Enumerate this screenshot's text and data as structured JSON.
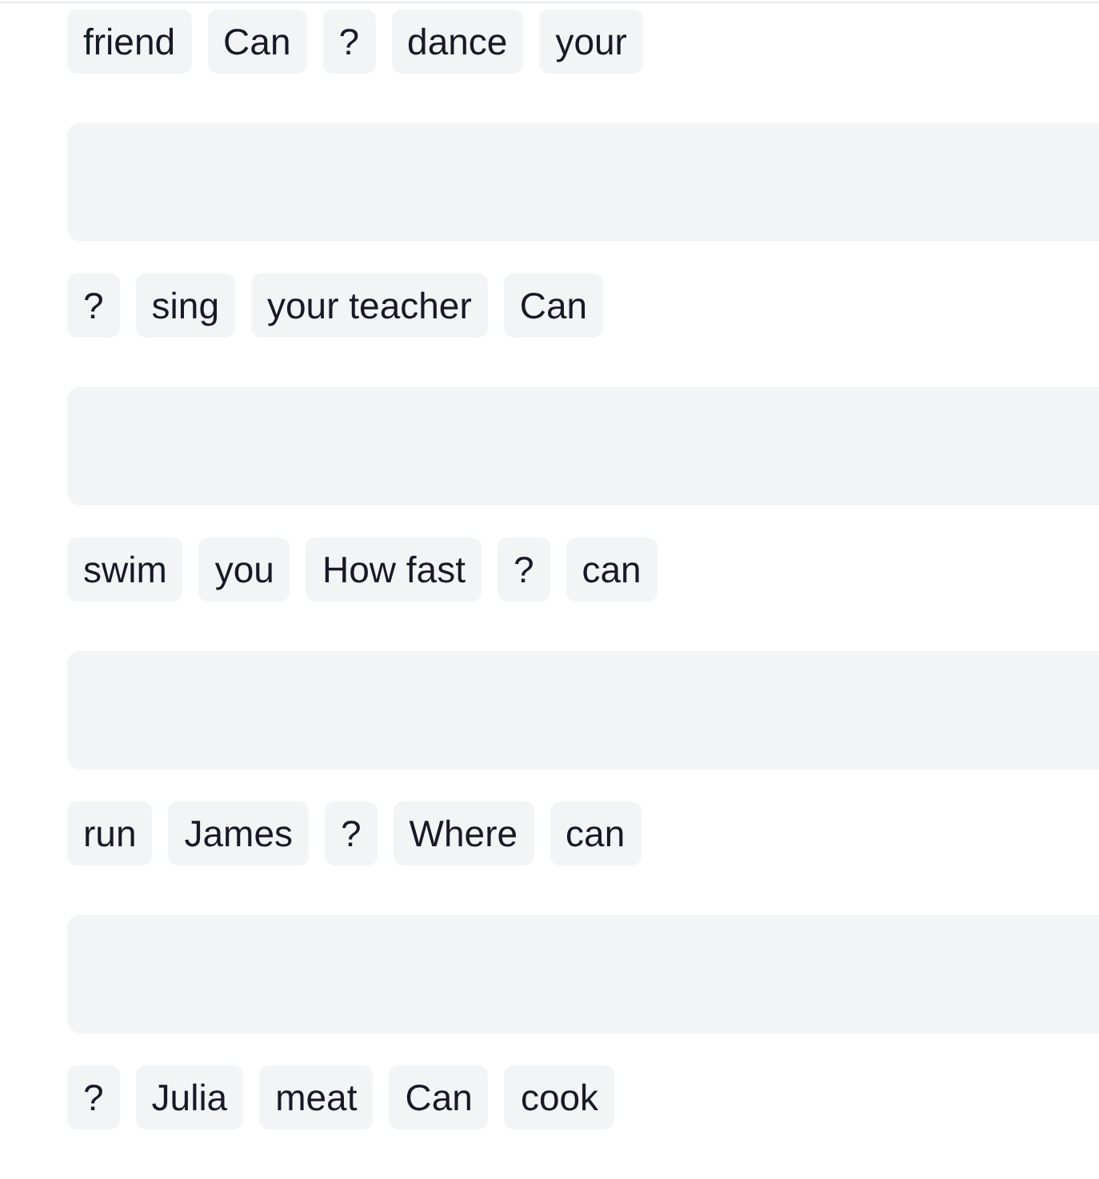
{
  "exercise_items": [
    {
      "kind": "word_tiles",
      "words": [
        "friend",
        "Can",
        "?",
        "dance",
        "your"
      ]
    },
    {
      "kind": "answer_box"
    },
    {
      "kind": "word_tiles",
      "words": [
        "?",
        "sing",
        "your teacher",
        "Can"
      ]
    },
    {
      "kind": "answer_box"
    },
    {
      "kind": "word_tiles",
      "words": [
        "swim",
        "you",
        "How fast",
        "?",
        "can"
      ]
    },
    {
      "kind": "answer_box"
    },
    {
      "kind": "word_tiles",
      "words": [
        "run",
        "James",
        "?",
        "Where",
        "can"
      ]
    },
    {
      "kind": "answer_box"
    },
    {
      "kind": "word_tiles",
      "words": [
        "?",
        "Julia",
        "meat",
        "Can",
        "cook"
      ]
    }
  ]
}
